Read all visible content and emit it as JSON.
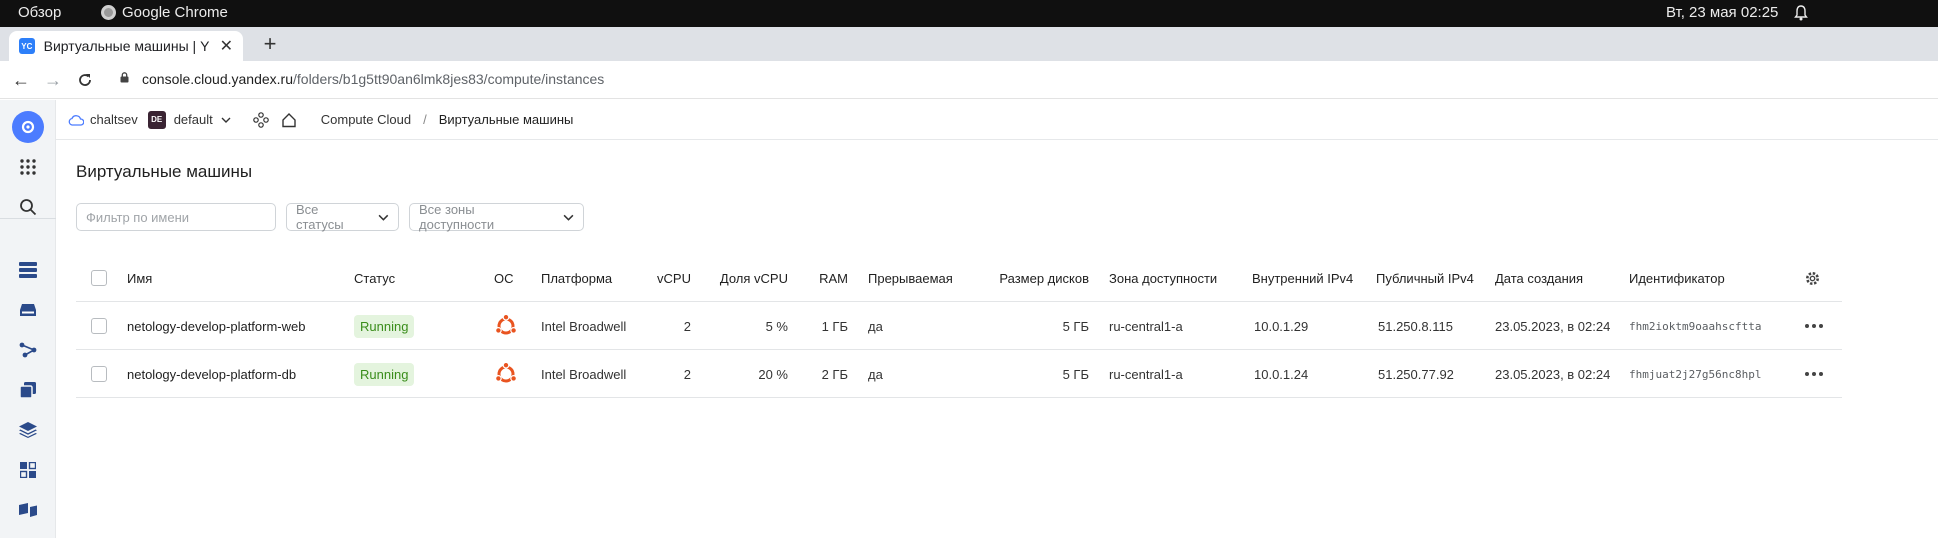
{
  "os": {
    "overview": "Обзор",
    "app_name": "Google Chrome",
    "datetime": "Вт, 23 мая  02:25"
  },
  "browser": {
    "tab_title": "Виртуальные машины | Y",
    "favicon_text": "YC",
    "url_host": "console.cloud.yandex.ru",
    "url_path": "/folders/b1g5tt90an6lmk8jes83/compute/instances"
  },
  "breadcrumbs": {
    "cloud": "chaltsev",
    "folder_badge": "DE",
    "folder": "default",
    "service": "Compute Cloud",
    "separator": "/",
    "current": "Виртуальные машины"
  },
  "page": {
    "title": "Виртуальные машины",
    "filter_placeholder": "Фильтр по имени",
    "status_select": "Все статусы",
    "zone_select": "Все зоны доступности"
  },
  "table": {
    "columns": {
      "name": "Имя",
      "status": "Статус",
      "os": "ОС",
      "platform": "Платформа",
      "vcpu": "vCPU",
      "vcpu_share": "Доля vCPU",
      "ram": "RAM",
      "preemptible": "Прерываемая",
      "disk": "Размер дисков",
      "zone": "Зона доступности",
      "internal_ip": "Внутренний IPv4",
      "public_ip": "Публичный IPv4",
      "created": "Дата создания",
      "id": "Идентификатор"
    },
    "rows": [
      {
        "name": "netology-develop-platform-web",
        "status": "Running",
        "os_icon": "ubuntu-icon",
        "platform": "Intel Broadwell",
        "vcpu": "2",
        "vcpu_share": "5 %",
        "ram": "1 ГБ",
        "preemptible": "да",
        "disk": "5 ГБ",
        "zone": "ru-central1-a",
        "internal_ip": "10.0.1.29",
        "public_ip": "51.250.8.115",
        "created": "23.05.2023, в 02:24",
        "id": "fhm2ioktm9oaahscftta"
      },
      {
        "name": "netology-develop-platform-db",
        "status": "Running",
        "os_icon": "ubuntu-icon",
        "platform": "Intel Broadwell",
        "vcpu": "2",
        "vcpu_share": "20 %",
        "ram": "2 ГБ",
        "preemptible": "да",
        "disk": "5 ГБ",
        "zone": "ru-central1-a",
        "internal_ip": "10.0.1.24",
        "public_ip": "51.250.77.92",
        "created": "23.05.2023, в 02:24",
        "id": "fhmjuat2j27g56nc8hpl"
      }
    ]
  },
  "colors": {
    "accent": "#4c7cff",
    "running_bg": "#e4f4de",
    "running_fg": "#3a8d1b",
    "ubuntu": "#e95420"
  }
}
